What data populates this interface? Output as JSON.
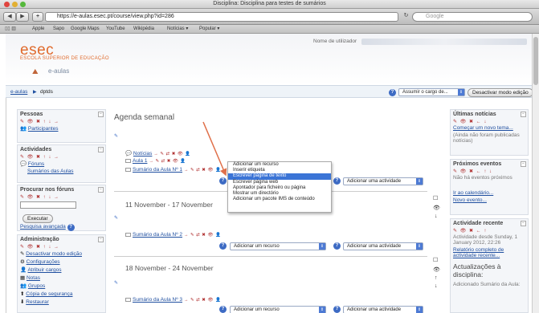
{
  "window": {
    "title": "Disciplina: Disciplina para testes de sumários",
    "url": "https://e-aulas.esec.pt/course/view.php?id=286",
    "search_placeholder": "Google"
  },
  "bookmarks": [
    "Apple",
    "Sapo",
    "Google Maps",
    "YouTube",
    "Wikipédia",
    "Notícias ▾",
    "Popular ▾"
  ],
  "header": {
    "logo": "esec",
    "logo_sub": "ESCOLA SUPERIOR DE EDUCAÇÃO",
    "site": "e-aulas",
    "user_label": "Nome de utilizador"
  },
  "nav": {
    "crumb_home": "e-aulas",
    "crumb_sep": "▶",
    "crumb_course": "dptds",
    "role_select": "Assumir o cargo de...",
    "edit_button": "Desactivar modo edição"
  },
  "left": {
    "pessoas": {
      "title": "Pessoas",
      "items": [
        "Participantes"
      ]
    },
    "atividades": {
      "title": "Actividades",
      "items": [
        "Fóruns",
        "Sumários das Aulas"
      ]
    },
    "procurar": {
      "title": "Procurar nos fóruns",
      "button": "Executar",
      "advanced": "Pesquisa avançada"
    },
    "admin": {
      "title": "Administração",
      "items": [
        "Desactivar modo edição",
        "Configurações",
        "Atribuir cargos",
        "Notas",
        "Grupos",
        "Cópia de segurança",
        "Restaurar"
      ]
    }
  },
  "main": {
    "title": "Agenda semanal",
    "week0": {
      "items": [
        "Notícias",
        "Aula 1",
        "Sumário da Aula Nº 1"
      ]
    },
    "week1": {
      "title": "11 November - 17 November",
      "items": [
        "Sumário da Aula Nº 2"
      ]
    },
    "week2": {
      "title": "18 November - 24 November",
      "items": [
        "Sumário da Aula Nº 3"
      ]
    },
    "add_resource": "Adicionar um recurso",
    "add_activity": "Adicionar uma actividade",
    "controls": "→ ✎ ⇄ ✖ 👁 👤",
    "dropdown": [
      "Adicionar um recurso",
      "Inserir etiqueta",
      "Escrever página de texto",
      "Escrever página web",
      "Apontador para ficheiro ou página",
      "Mostrar um directório",
      "Adicionar um pacote IMS de conteúdo"
    ],
    "dropdown_selected": 2
  },
  "right": {
    "news": {
      "title": "Últimas notícias",
      "link": "Começar um novo tema...",
      "note": "(Ainda não foram publicadas notícias)"
    },
    "events": {
      "title": "Próximos eventos",
      "note": "Não há eventos próximos",
      "calendar": "Ir ao calendário...",
      "new_event": "Novo evento..."
    },
    "activity": {
      "title": "Actividade recente",
      "since": "Actividade desde Sunday, 1 January 2012, 22:26",
      "report": "Relatório completo de actividade recente...",
      "updates": "Actualizações à disciplina:",
      "added": "Adicionado Sumário da Aula:"
    }
  },
  "colors": {
    "accent": "#e06a2c",
    "link": "#1f4fa0",
    "selection": "#3b74d6",
    "arrow": "#e0704a"
  }
}
